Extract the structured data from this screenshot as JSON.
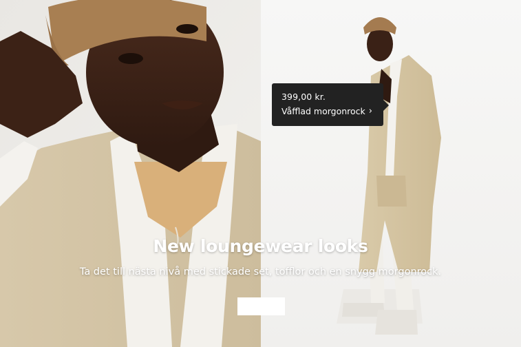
{
  "hero": {
    "product_tooltip": {
      "price": "399,00 kr.",
      "name": "Våfflad morgonrock",
      "chevron_icon": "chevron-right-icon"
    },
    "headline": "New loungewear looks",
    "subline": "Ta det till nästa nivå med stickade set, tofflor och en snygg morgonrock.",
    "cta_label": ""
  }
}
